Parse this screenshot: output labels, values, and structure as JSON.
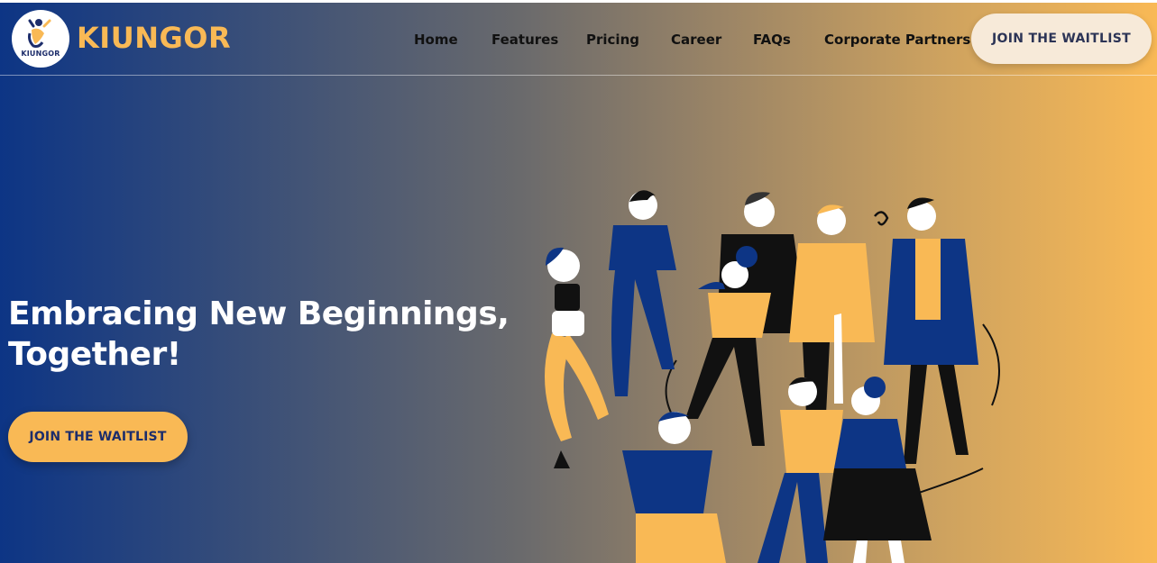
{
  "brand": {
    "name": "KIUNGOR",
    "logo_text": "KIUNGOR",
    "accent_color": "#f9b955",
    "navy_color": "#0d3585"
  },
  "nav": {
    "items": [
      {
        "label": "Home"
      },
      {
        "label": "Features"
      },
      {
        "label": "Pricing"
      },
      {
        "label": "Career"
      },
      {
        "label": "FAQs"
      },
      {
        "label": "Corporate Partners"
      }
    ],
    "cta_label": "JOIN THE WAITLIST"
  },
  "hero": {
    "title_line1": "Embracing New Beginnings,",
    "title_line2": "Together!",
    "cta_label": "JOIN THE WAITLIST",
    "illustration_icon": "group-of-people-illustration"
  }
}
